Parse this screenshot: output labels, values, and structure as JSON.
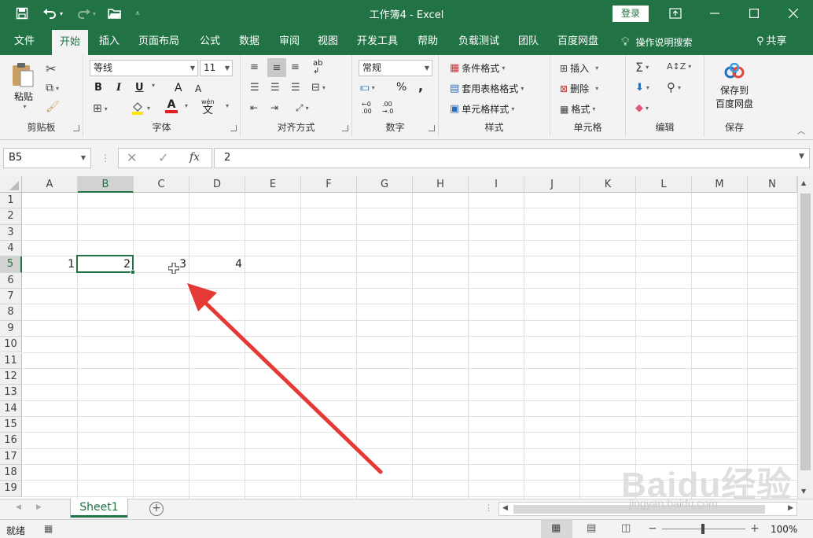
{
  "window": {
    "title": "工作簿4 - Excel",
    "login_label": "登录"
  },
  "menu": {
    "tabs": [
      "文件",
      "开始",
      "插入",
      "页面布局",
      "公式",
      "数据",
      "审阅",
      "视图",
      "开发工具",
      "帮助",
      "负载测试",
      "团队",
      "百度网盘"
    ],
    "active_tab": "开始",
    "tellme": "操作说明搜索",
    "share": "共享"
  },
  "ribbon": {
    "clipboard": {
      "label": "剪贴板",
      "paste": "粘贴"
    },
    "font": {
      "label": "字体",
      "font_name": "等线",
      "font_size": "11",
      "bold": "B",
      "italic": "I",
      "underline": "U",
      "grow": "A",
      "shrink": "A",
      "font_color": "A",
      "wen": "wén"
    },
    "alignment": {
      "label": "对齐方式"
    },
    "number": {
      "label": "数字",
      "format": "常规",
      "percent": "%",
      "comma": ","
    },
    "styles": {
      "label": "样式",
      "conditional": "条件格式",
      "table": "套用表格格式",
      "cell_styles": "单元格样式"
    },
    "cells": {
      "label": "单元格",
      "insert": "插入",
      "delete": "删除",
      "format": "格式"
    },
    "editing": {
      "label": "编辑"
    },
    "save": {
      "label": "保存",
      "save_to_line1": "保存到",
      "save_to_line2": "百度网盘"
    }
  },
  "formula_bar": {
    "name_box": "B5",
    "formula": "2"
  },
  "grid": {
    "columns": [
      "A",
      "B",
      "C",
      "D",
      "E",
      "F",
      "G",
      "H",
      "I",
      "J",
      "K",
      "L",
      "M",
      "N"
    ],
    "rows": [
      "1",
      "2",
      "3",
      "4",
      "5",
      "6",
      "7",
      "8",
      "9",
      "10",
      "11",
      "12",
      "13",
      "14",
      "15",
      "16",
      "17",
      "18",
      "19"
    ],
    "selected_column": "B",
    "selected_row": "5",
    "cells": {
      "A5": "1",
      "B5": "2",
      "C5": "3",
      "D5": "4"
    }
  },
  "sheets": {
    "tabs": [
      "Sheet1"
    ]
  },
  "status": {
    "ready": "就绪",
    "zoom": "100%"
  },
  "watermark": {
    "brand": "Baidu经验",
    "url": "jingyan.baidu.com"
  },
  "colors": {
    "accent": "#217346",
    "arrow": "#e53935"
  }
}
